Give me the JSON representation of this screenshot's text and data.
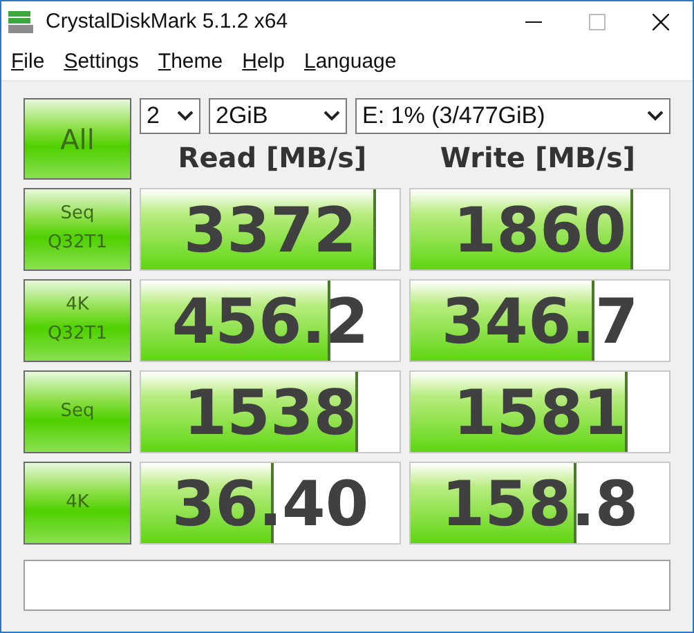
{
  "window": {
    "title": "CrystalDiskMark 5.1.2 x64"
  },
  "menu": [
    {
      "label": "File"
    },
    {
      "label": "Settings"
    },
    {
      "label": "Theme"
    },
    {
      "label": "Help"
    },
    {
      "label": "Language"
    }
  ],
  "all_button": {
    "label": "All"
  },
  "selectors": [
    {
      "value": "2"
    },
    {
      "value": "2GiB"
    },
    {
      "value": "E: 1% (3/477GiB)"
    }
  ],
  "headers": [
    "Read [MB/s]",
    "Write [MB/s]"
  ],
  "rows": [
    {
      "label": [
        "Seq",
        "Q32T1"
      ],
      "read": {
        "value": "3372",
        "level": 0.9
      },
      "write": {
        "value": "1860",
        "level": 0.85
      }
    },
    {
      "label": [
        "4K",
        "Q32T1"
      ],
      "read": {
        "value": "456.2",
        "level": 0.72
      },
      "write": {
        "value": "346.7",
        "level": 0.7
      }
    },
    {
      "label": [
        "Seq"
      ],
      "read": {
        "value": "1538",
        "level": 0.83
      },
      "write": {
        "value": "1581",
        "level": 0.83
      }
    },
    {
      "label": [
        "4K"
      ],
      "read": {
        "value": "36.40",
        "level": 0.5
      },
      "write": {
        "value": "158.8",
        "level": 0.63
      }
    }
  ]
}
